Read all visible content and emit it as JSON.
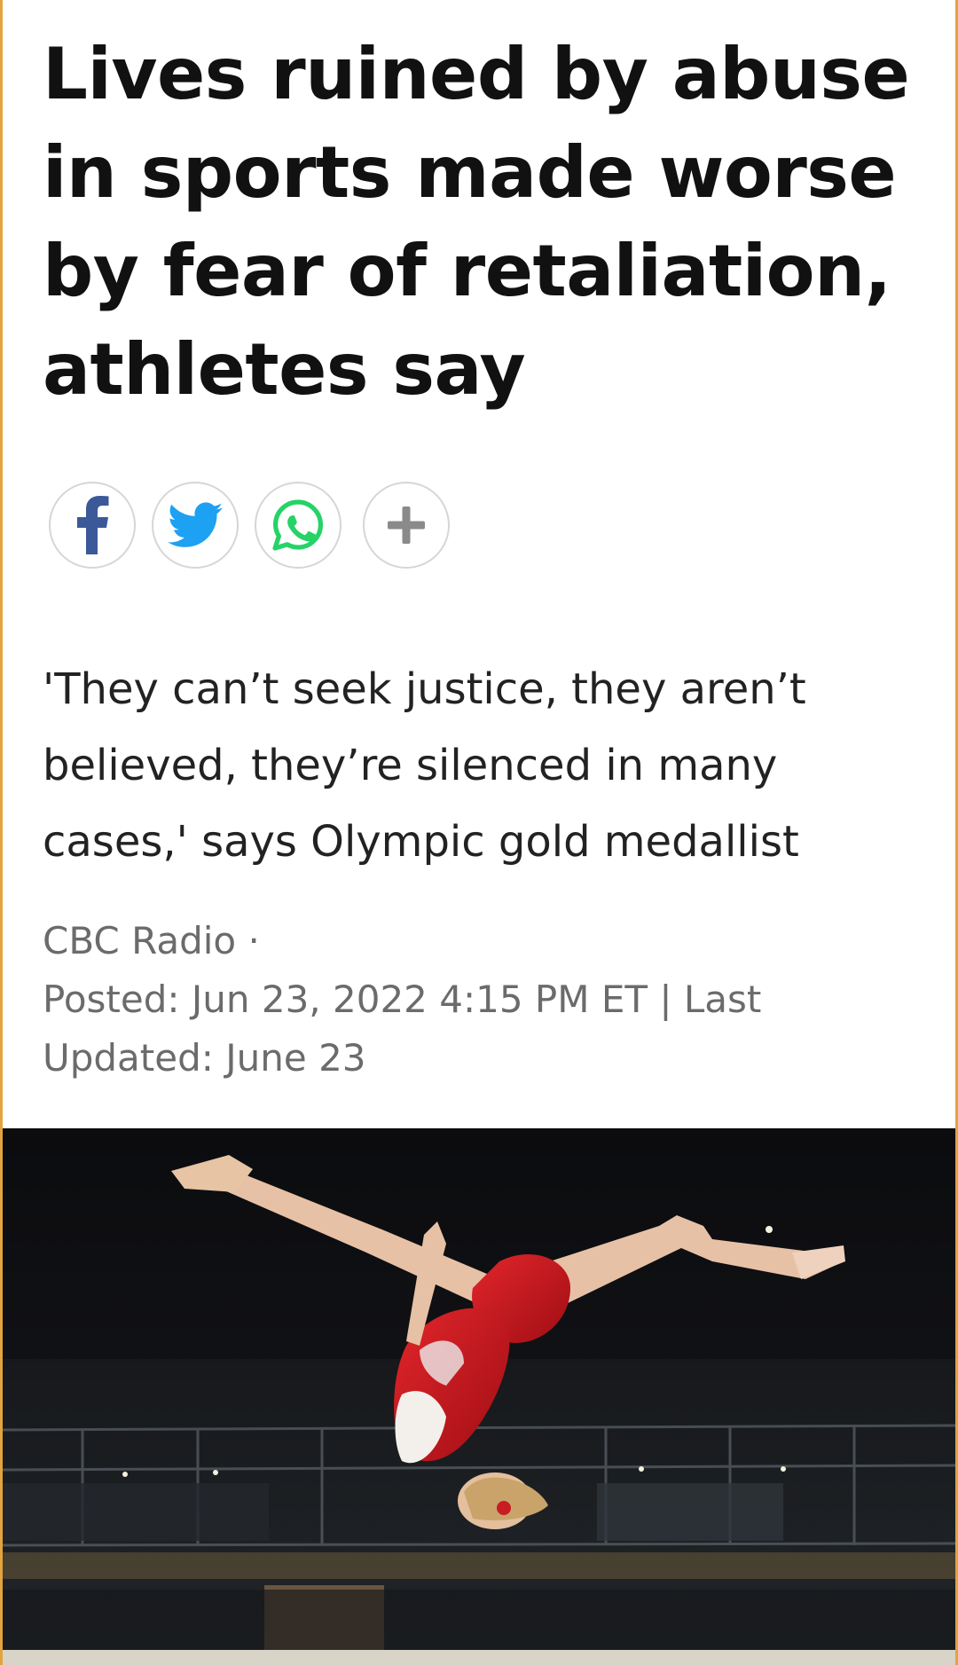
{
  "article": {
    "headline": "Lives ruined by abuse in sports made worse by fear of retaliation, athletes say",
    "deck": "'They can’t seek justice, they aren’t believed, they’re silenced in many cases,' says Olympic gold medallist",
    "source": "CBC Radio ·",
    "posted": "Posted: Jun 23, 2022 4:15 PM ET | Last Updated: June 23"
  },
  "share": {
    "buttons": [
      {
        "icon": "facebook-icon",
        "color": "#3b5998"
      },
      {
        "icon": "twitter-icon",
        "color": "#1da1f2"
      },
      {
        "icon": "whatsapp-icon",
        "color": "#25d366"
      },
      {
        "icon": "plus-icon",
        "color": "#8a8a8a"
      }
    ]
  },
  "colors": {
    "frame_accent": "#e3a43d",
    "headline": "#111111",
    "deck": "#222222",
    "byline": "#6b6b6b"
  }
}
